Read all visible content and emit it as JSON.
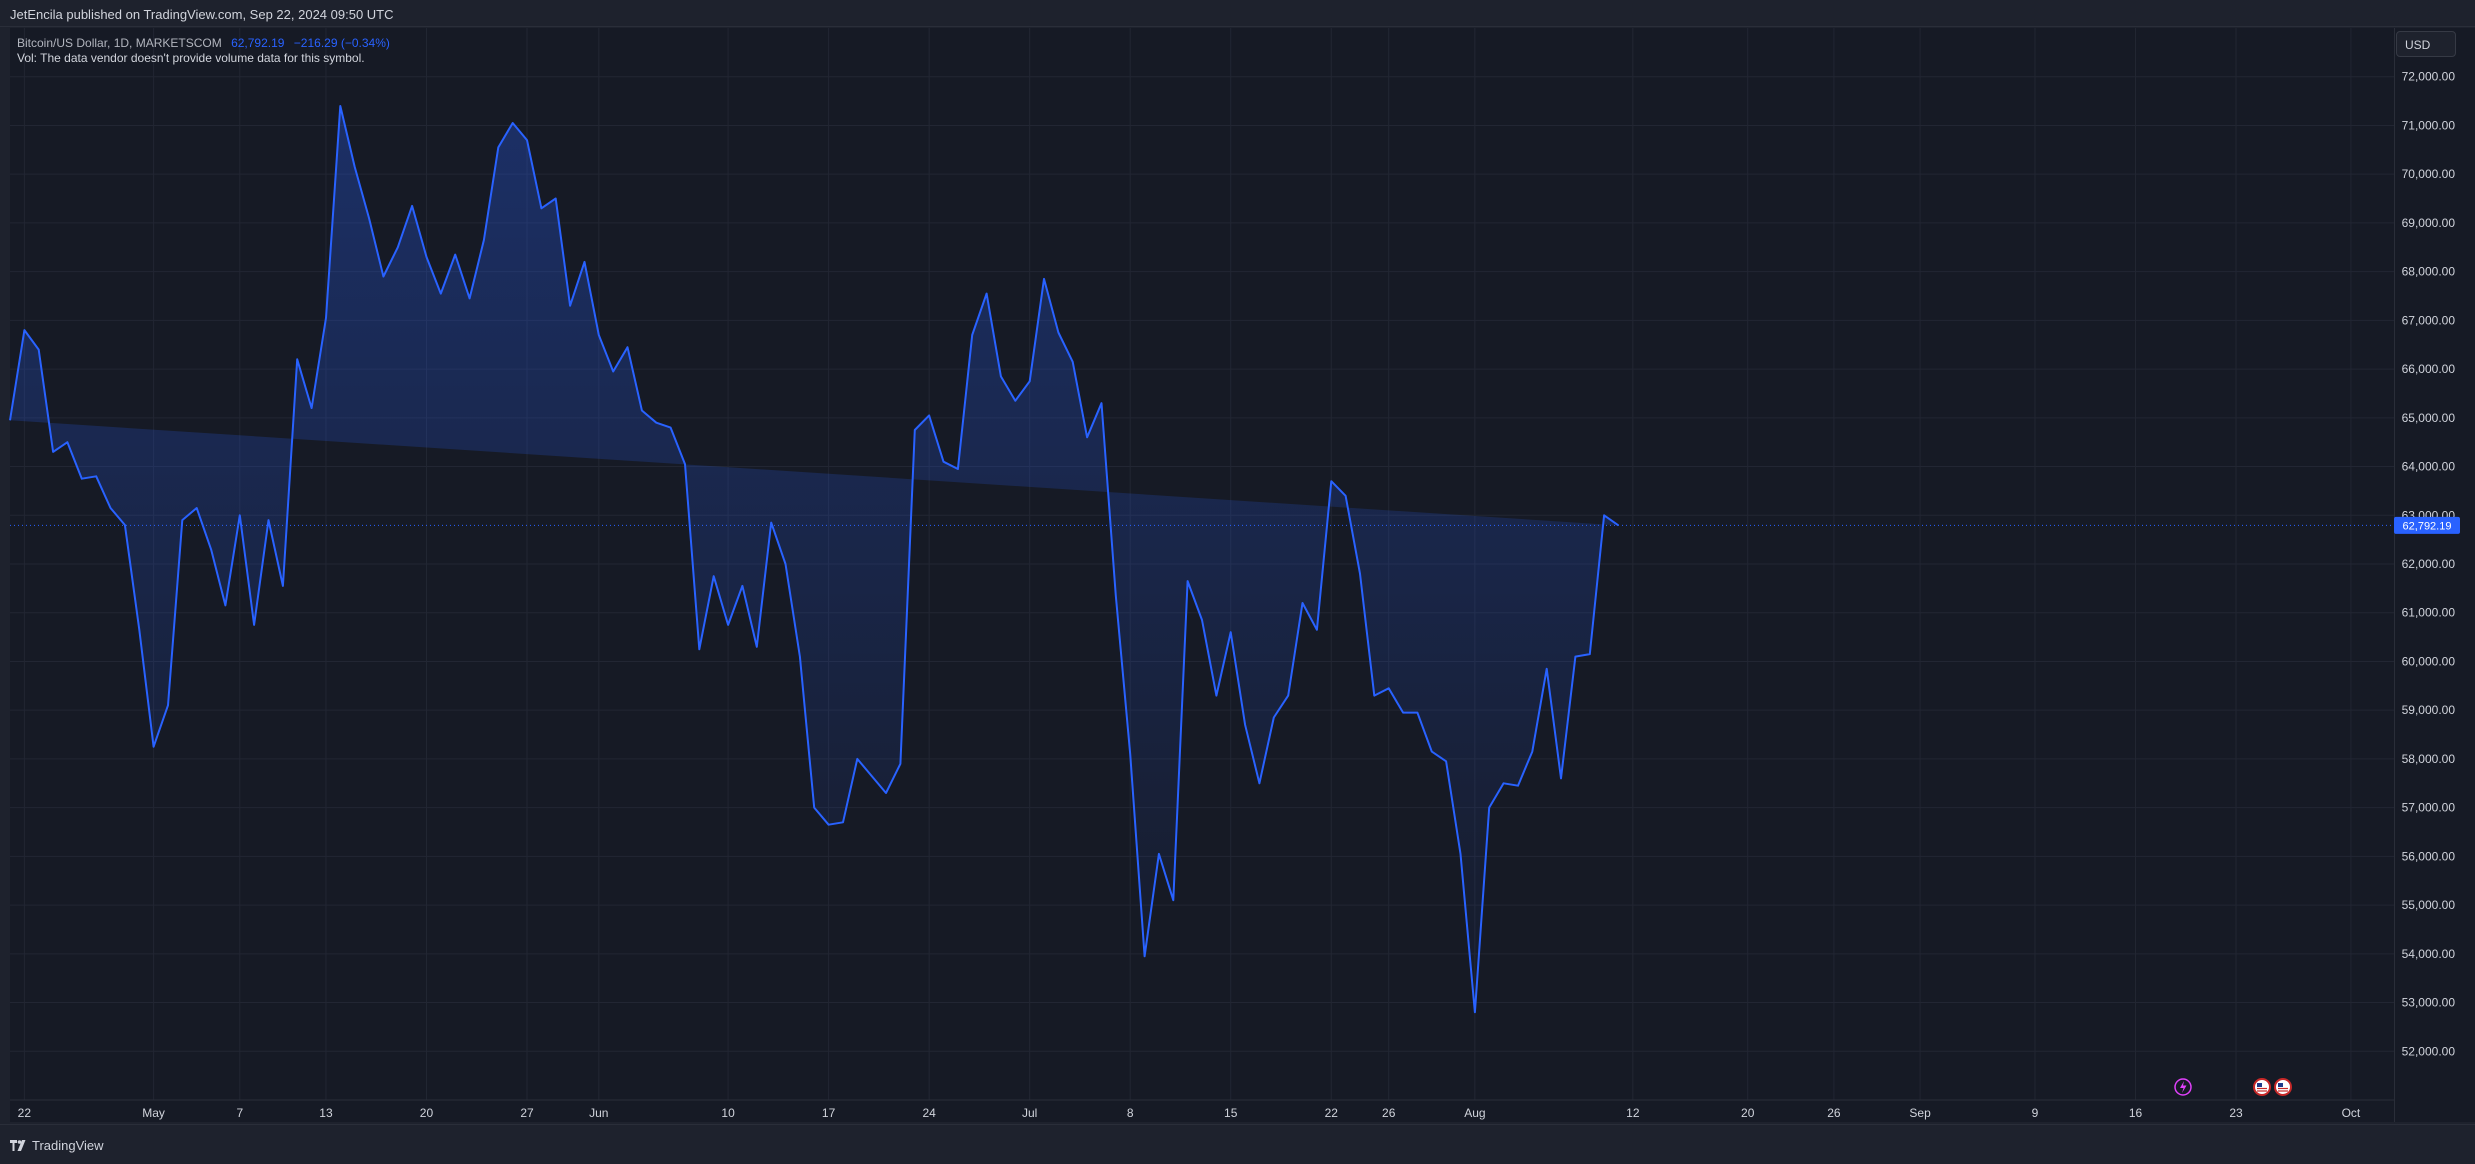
{
  "header": {
    "published": "JetEncila published on TradingView.com, Sep 22, 2024 09:50 UTC"
  },
  "legend": {
    "symbol": "Bitcoin/US Dollar, 1D, MARKETSCOM",
    "last_value": "62,792.19",
    "change": "−216.29 (−0.34%)",
    "volume_note": "Vol: The data vendor doesn't provide volume data for this symbol."
  },
  "price_axis": {
    "currency": "USD",
    "current_price_label": "62,792.19"
  },
  "footer": {
    "brand": "TradingView"
  },
  "colors": {
    "line": "#2962ff",
    "background": "#161a25",
    "price_tag": "#2962ff"
  },
  "icons": [
    "lightning-event-icon",
    "us-flag-event-icon",
    "us-flag-event-icon"
  ],
  "chart_data": {
    "type": "area",
    "ylim": [
      51000,
      73000
    ],
    "y_ticks": [
      52000,
      53000,
      54000,
      55000,
      56000,
      57000,
      58000,
      59000,
      60000,
      61000,
      62000,
      63000,
      64000,
      65000,
      66000,
      67000,
      68000,
      69000,
      70000,
      71000,
      72000
    ],
    "y_tick_labels": [
      "52,000.00",
      "53,000.00",
      "54,000.00",
      "55,000.00",
      "56,000.00",
      "57,000.00",
      "58,000.00",
      "59,000.00",
      "60,000.00",
      "61,000.00",
      "62,000.00",
      "63,000.00",
      "64,000.00",
      "65,000.00",
      "66,000.00",
      "67,000.00",
      "68,000.00",
      "69,000.00",
      "70,000.00",
      "71,000.00",
      "72,000.00"
    ],
    "x_ticks": [
      {
        "date": "2024-04-22",
        "label": "22"
      },
      {
        "date": "2024-05-01",
        "label": "May"
      },
      {
        "date": "2024-05-07",
        "label": "7"
      },
      {
        "date": "2024-05-13",
        "label": "13"
      },
      {
        "date": "2024-05-20",
        "label": "20"
      },
      {
        "date": "2024-05-27",
        "label": "27"
      },
      {
        "date": "2024-06-01",
        "label": "Jun"
      },
      {
        "date": "2024-06-10",
        "label": "10"
      },
      {
        "date": "2024-06-17",
        "label": "17"
      },
      {
        "date": "2024-06-24",
        "label": "24"
      },
      {
        "date": "2024-07-01",
        "label": "Jul"
      },
      {
        "date": "2024-07-08",
        "label": "8"
      },
      {
        "date": "2024-07-15",
        "label": "15"
      },
      {
        "date": "2024-07-22",
        "label": "22"
      },
      {
        "date": "2024-07-26",
        "label": "26"
      },
      {
        "date": "2024-08-01",
        "label": "Aug"
      },
      {
        "date": "2024-08-12",
        "label": "12"
      },
      {
        "date": "2024-08-20",
        "label": "20"
      },
      {
        "date": "2024-08-26",
        "label": "26"
      },
      {
        "date": "2024-09-01",
        "label": "Sep"
      },
      {
        "date": "2024-09-09",
        "label": "9"
      },
      {
        "date": "2024-09-16",
        "label": "16"
      },
      {
        "date": "2024-09-23",
        "label": "23"
      },
      {
        "date": "2024-10-01",
        "label": "Oct"
      }
    ],
    "x_range": [
      "2024-04-21",
      "2024-10-04"
    ],
    "current_price": 62792.19,
    "series": [
      {
        "dates": [
          "2024-04-21",
          "2024-04-22",
          "2024-04-23",
          "2024-04-24",
          "2024-04-25",
          "2024-04-26",
          "2024-04-27",
          "2024-04-28",
          "2024-04-29",
          "2024-04-30",
          "2024-05-01",
          "2024-05-02",
          "2024-05-03",
          "2024-05-04",
          "2024-05-05",
          "2024-05-06",
          "2024-05-07",
          "2024-05-08",
          "2024-05-09",
          "2024-05-10",
          "2024-05-11",
          "2024-05-12",
          "2024-05-13",
          "2024-05-14",
          "2024-05-15",
          "2024-05-16",
          "2024-05-17",
          "2024-05-18",
          "2024-05-19",
          "2024-05-20",
          "2024-05-21",
          "2024-05-22",
          "2024-05-23",
          "2024-05-24",
          "2024-05-25",
          "2024-05-26",
          "2024-05-27",
          "2024-05-28",
          "2024-05-29",
          "2024-05-30",
          "2024-05-31",
          "2024-06-01",
          "2024-06-02",
          "2024-06-03",
          "2024-06-04",
          "2024-06-05",
          "2024-06-06",
          "2024-06-07",
          "2024-06-08",
          "2024-06-09",
          "2024-06-10",
          "2024-06-11",
          "2024-06-12",
          "2024-06-13",
          "2024-06-14",
          "2024-06-15",
          "2024-06-16",
          "2024-06-17",
          "2024-06-18",
          "2024-06-19",
          "2024-06-20",
          "2024-06-21",
          "2024-06-22",
          "2024-06-23",
          "2024-06-24",
          "2024-06-25",
          "2024-06-26",
          "2024-06-27",
          "2024-06-28",
          "2024-06-29",
          "2024-06-30",
          "2024-07-01",
          "2024-07-02",
          "2024-07-03",
          "2024-07-04",
          "2024-07-05",
          "2024-07-06",
          "2024-07-07",
          "2024-07-08",
          "2024-07-09",
          "2024-07-10",
          "2024-07-11",
          "2024-07-12",
          "2024-07-13",
          "2024-07-14",
          "2024-07-15",
          "2024-07-16",
          "2024-07-17",
          "2024-07-18",
          "2024-07-19",
          "2024-07-20",
          "2024-07-21",
          "2024-07-22",
          "2024-07-23",
          "2024-07-24",
          "2024-07-25",
          "2024-07-26",
          "2024-07-27",
          "2024-07-28",
          "2024-07-29",
          "2024-07-30",
          "2024-07-31",
          "2024-08-01",
          "2024-08-02",
          "2024-08-03",
          "2024-08-04",
          "2024-08-05",
          "2024-08-06",
          "2024-08-07",
          "2024-08-08",
          "2024-08-09",
          "2024-08-10",
          "2024-08-11",
          "2024-08-12",
          "2024-08-13",
          "2024-08-14",
          "2024-08-15",
          "2024-08-16",
          "2024-08-17",
          "2024-08-18",
          "2024-08-19",
          "2024-08-20",
          "2024-08-21",
          "2024-08-22",
          "2024-08-23",
          "2024-08-24",
          "2024-08-25",
          "2024-08-26",
          "2024-08-27",
          "2024-08-28",
          "2024-08-29",
          "2024-08-30",
          "2024-08-31",
          "2024-09-01",
          "2024-09-02",
          "2024-09-03",
          "2024-09-04",
          "2024-09-05",
          "2024-09-06",
          "2024-09-07",
          "2024-09-08",
          "2024-09-09",
          "2024-09-10",
          "2024-09-11",
          "2024-09-12",
          "2024-09-13",
          "2024-09-14",
          "2024-09-15",
          "2024-09-16",
          "2024-09-17",
          "2024-09-18",
          "2024-09-19",
          "2024-09-20",
          "2024-09-21",
          "2024-09-22"
        ],
        "values": [
          64950,
          66800,
          66400,
          64300,
          64500,
          63750,
          63800,
          63150,
          62800,
          60650,
          58250,
          59100,
          62900,
          63150,
          62300,
          61150,
          63000,
          60750,
          62900,
          61550,
          66200,
          65200,
          67050,
          71400,
          70150,
          69100,
          67900,
          68500,
          69350,
          68300,
          67550,
          68350,
          67450,
          68650,
          70550,
          71050,
          70700,
          69300,
          69500,
          67300,
          68200,
          66700,
          65950,
          66450,
          65150,
          64900,
          64800,
          64050,
          60250,
          61750,
          60750,
          61550,
          60300,
          62850,
          62000,
          60100,
          57000,
          56650,
          56700,
          58000,
          57650,
          57300,
          57900,
          64750,
          65050,
          64100,
          63950,
          66700,
          67550,
          65850,
          65350,
          65750,
          67850,
          66750,
          66150,
          64600,
          65300,
          61350,
          58100,
          53950,
          56050,
          55100,
          61650,
          60850,
          59300,
          60600,
          58700,
          57500,
          58850,
          59300,
          61200,
          60650,
          63700,
          63400,
          61800,
          59300,
          59450,
          58950,
          58950,
          58150,
          57950,
          56050,
          52800,
          57000,
          57500,
          57450,
          58150,
          59850,
          57600,
          60100,
          60150,
          63000,
          62792
        ]
      }
    ]
  }
}
